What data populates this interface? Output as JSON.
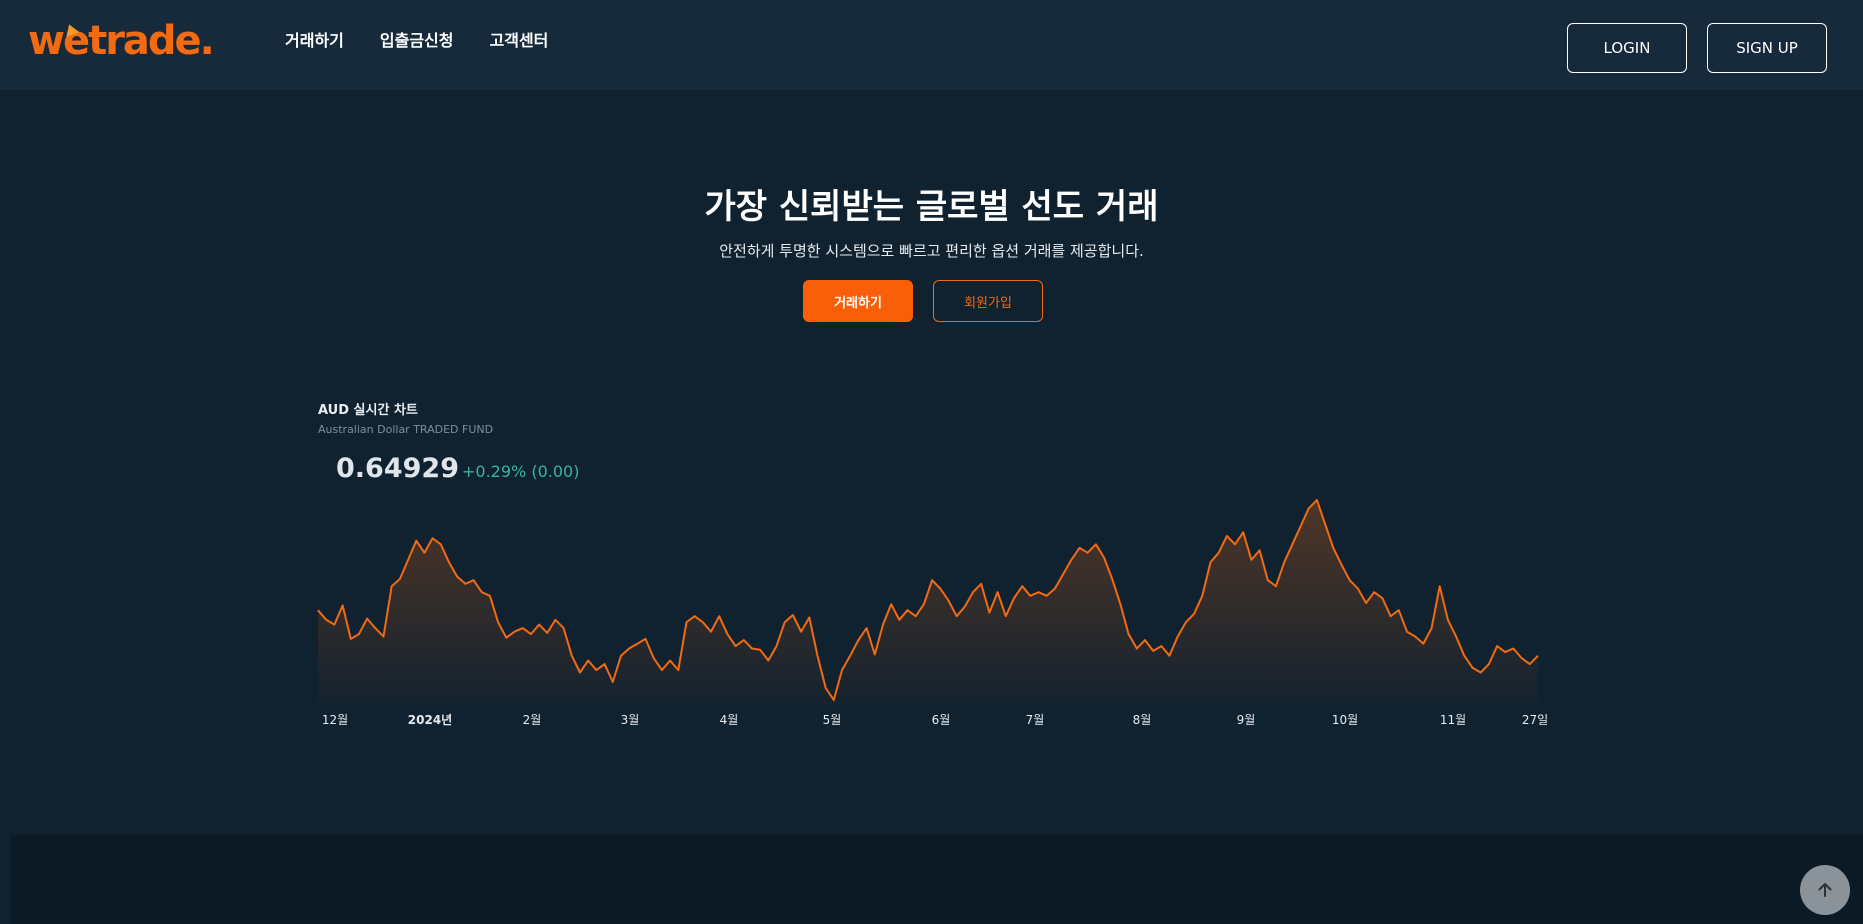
{
  "header": {
    "logo_text": "wetrade.",
    "nav": [
      "거래하기",
      "입출금신청",
      "고객센터"
    ],
    "login_label": "LOGIN",
    "signup_label": "SIGN UP"
  },
  "hero": {
    "title": "가장 신뢰받는 글로벌 선도 거래",
    "subtitle": "안전하게 투명한 시스템으로 빠르고 편리한 옵션 거래를 제공합니다.",
    "trade_button": "거래하기",
    "join_button": "회원가입"
  },
  "colors": {
    "brand": "#f95f08",
    "background": "#10212f",
    "header": "#162a3b",
    "positive": "#33b79a",
    "line": "#f26a12"
  },
  "chart_data": {
    "type": "area",
    "title": "AUD 실시간 차트",
    "subtitle": "Australian Dollar TRADED FUND",
    "price": "0.64929",
    "change": "+0.29% (0.00)",
    "x_labels": [
      "12월",
      "2024년",
      "2월",
      "3월",
      "4월",
      "5월",
      "6월",
      "7월",
      "8월",
      "9월",
      "10월",
      "11월",
      "27일"
    ],
    "y": [
      0.647,
      0.6462,
      0.6458,
      0.6474,
      0.6446,
      0.645,
      0.6463,
      0.6455,
      0.6448,
      0.649,
      0.6496,
      0.6512,
      0.6528,
      0.6518,
      0.653,
      0.6525,
      0.651,
      0.6498,
      0.6492,
      0.6495,
      0.6485,
      0.6482,
      0.646,
      0.6447,
      0.6452,
      0.6455,
      0.645,
      0.6458,
      0.6451,
      0.6462,
      0.6455,
      0.6432,
      0.6418,
      0.6428,
      0.642,
      0.6425,
      0.641,
      0.6432,
      0.6438,
      0.6442,
      0.6446,
      0.643,
      0.642,
      0.6428,
      0.642,
      0.646,
      0.6465,
      0.646,
      0.6452,
      0.6465,
      0.645,
      0.644,
      0.6445,
      0.6438,
      0.6437,
      0.6428,
      0.644,
      0.646,
      0.6466,
      0.6452,
      0.6464,
      0.6432,
      0.6405,
      0.6395,
      0.642,
      0.6432,
      0.6445,
      0.6455,
      0.6433,
      0.6458,
      0.6475,
      0.6462,
      0.647,
      0.6465,
      0.6475,
      0.6495,
      0.6488,
      0.6478,
      0.6465,
      0.6473,
      0.6485,
      0.6492,
      0.6468,
      0.6485,
      0.6465,
      0.648,
      0.649,
      0.6482,
      0.6485,
      0.6482,
      0.6488,
      0.65,
      0.6512,
      0.6522,
      0.6518,
      0.6525,
      0.6514,
      0.6496,
      0.6475,
      0.645,
      0.6438,
      0.6445,
      0.6436,
      0.644,
      0.6432,
      0.6448,
      0.646,
      0.6467,
      0.6482,
      0.651,
      0.6518,
      0.6532,
      0.6525,
      0.6535,
      0.6512,
      0.652,
      0.6495,
      0.649,
      0.651,
      0.6525,
      0.654,
      0.6555,
      0.6562,
      0.6542,
      0.6522,
      0.6508,
      0.6495,
      0.6488,
      0.6476,
      0.6485,
      0.648,
      0.6465,
      0.647,
      0.6452,
      0.6448,
      0.6442,
      0.6455,
      0.649,
      0.6462,
      0.6448,
      0.6432,
      0.6422,
      0.6418,
      0.6425,
      0.644,
      0.6435,
      0.6438,
      0.643,
      0.6425,
      0.6432
    ],
    "grid": false,
    "legend": "none"
  },
  "scroll_top_icon": "arrow-up-icon"
}
